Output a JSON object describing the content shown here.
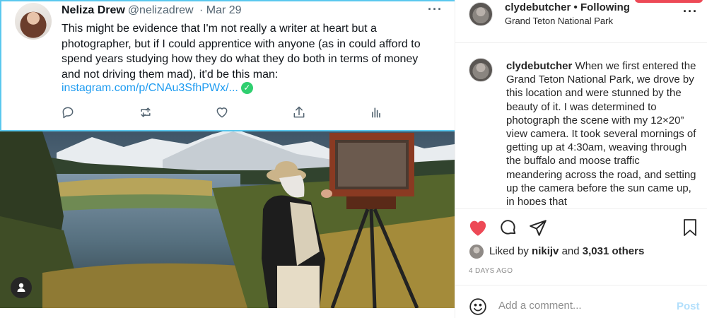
{
  "tweet": {
    "author_name": "Neliza Drew",
    "author_handle": "@nelizadrew",
    "date": "· Mar 29",
    "more": "···",
    "lines": [
      "This might be evidence that I'm not really a writer at heart but a",
      "photographer, but if I could apprentice with anyone (as in could afford to",
      "spend years studying how they do what they do both in terms of money",
      "and not driving them mad), it'd be this man:"
    ],
    "link": "instagram.com/p/CNAu3SfhPWx/...",
    "check_icon": "✓",
    "actions": [
      "reply-icon",
      "retweet-icon",
      "like-icon",
      "share-icon",
      "analytics-icon"
    ]
  },
  "instagram": {
    "username": "clydebutcher",
    "follow_status": "• Following",
    "location": "Grand Teton National Park",
    "more": "···",
    "caption_user": "clydebutcher",
    "caption_text": " When we first entered the Grand Teton National Park, we drove by this location and were stunned by the beauty of it. I was determined to photograph the scene with my 12×20” view camera. It took several mornings of getting up at 4:30am, weaving through the buffalo and moose traffic meandering across the road, and setting up the camera before the sun came up, in hopes that",
    "liked_prefix": "Liked by ",
    "liked_user": "nikijv",
    "liked_and": " and ",
    "liked_count": "3,031 others",
    "time_ago": "4 DAYS AGO",
    "comment_placeholder": "Add a comment...",
    "post_label": "Post",
    "heart_color": "#ed4956",
    "accent_color": "#0095f6"
  },
  "colors": {
    "tweet_border": "#5bc8ee",
    "link": "#1d9bf0",
    "verified_check": "#2fcf6f"
  }
}
